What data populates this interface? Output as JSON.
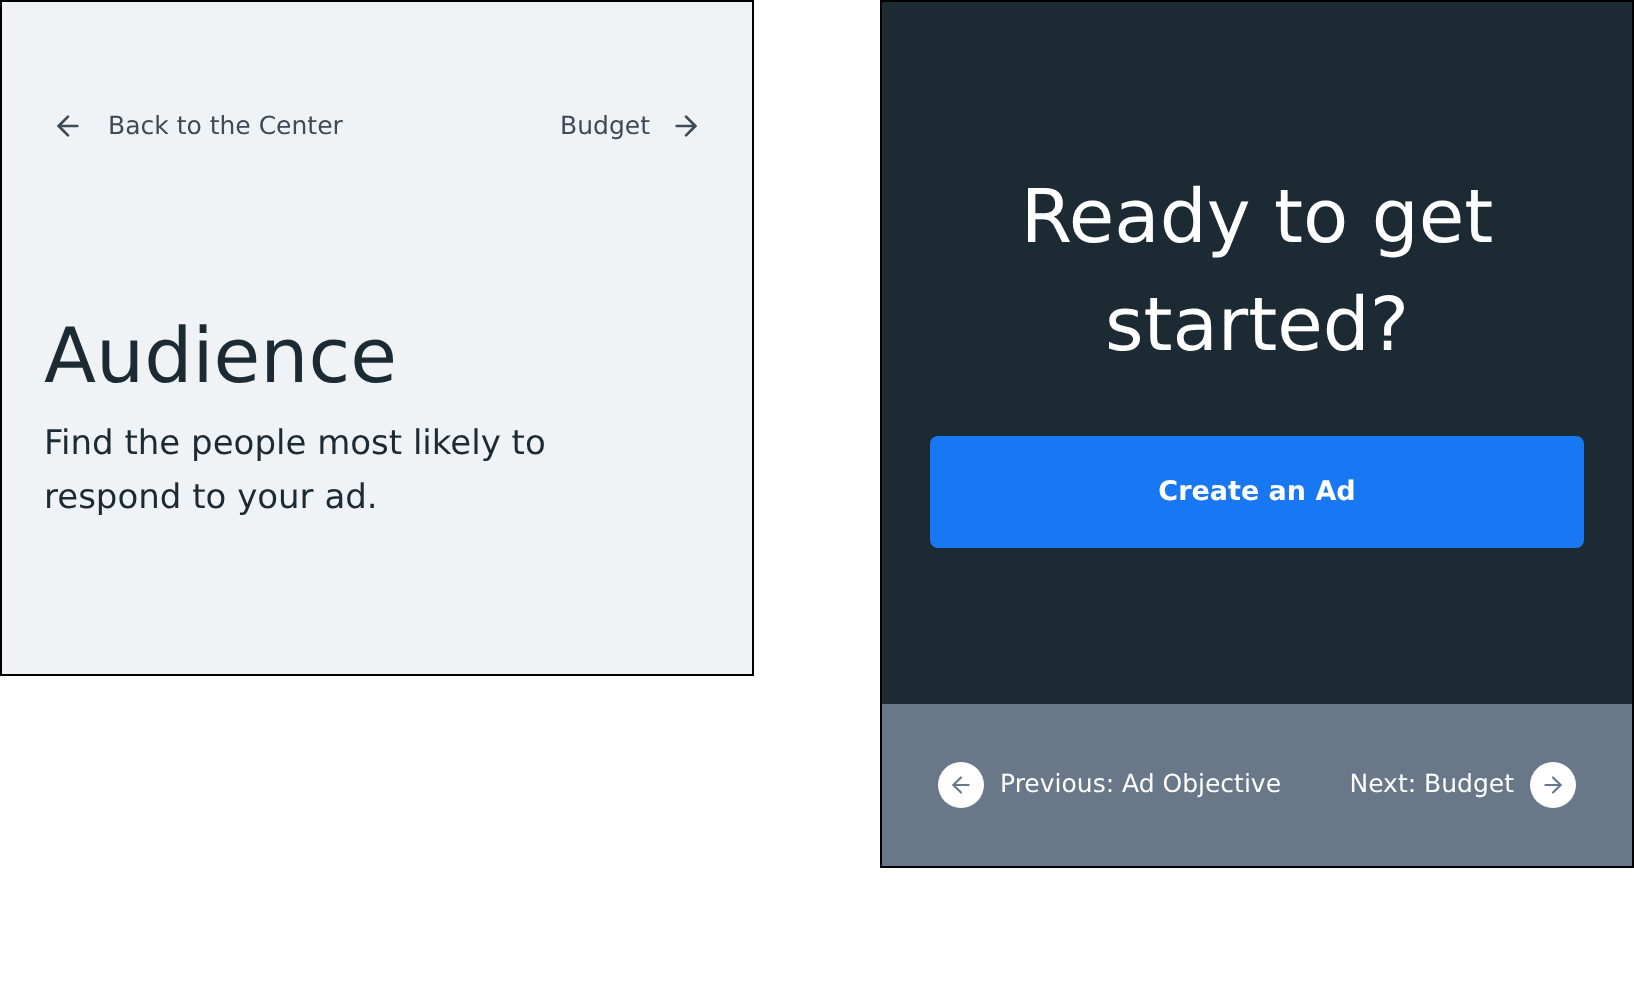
{
  "audience_card": {
    "back_link": "Back to the Center",
    "next_link": "Budget",
    "title": "Audience",
    "description": "Find the people most likely to respond to your ad."
  },
  "cta_card": {
    "heading": "Ready to get started?",
    "button": "Create an Ad",
    "previous": "Previous: Ad Objective",
    "next": "Next: Budget"
  }
}
